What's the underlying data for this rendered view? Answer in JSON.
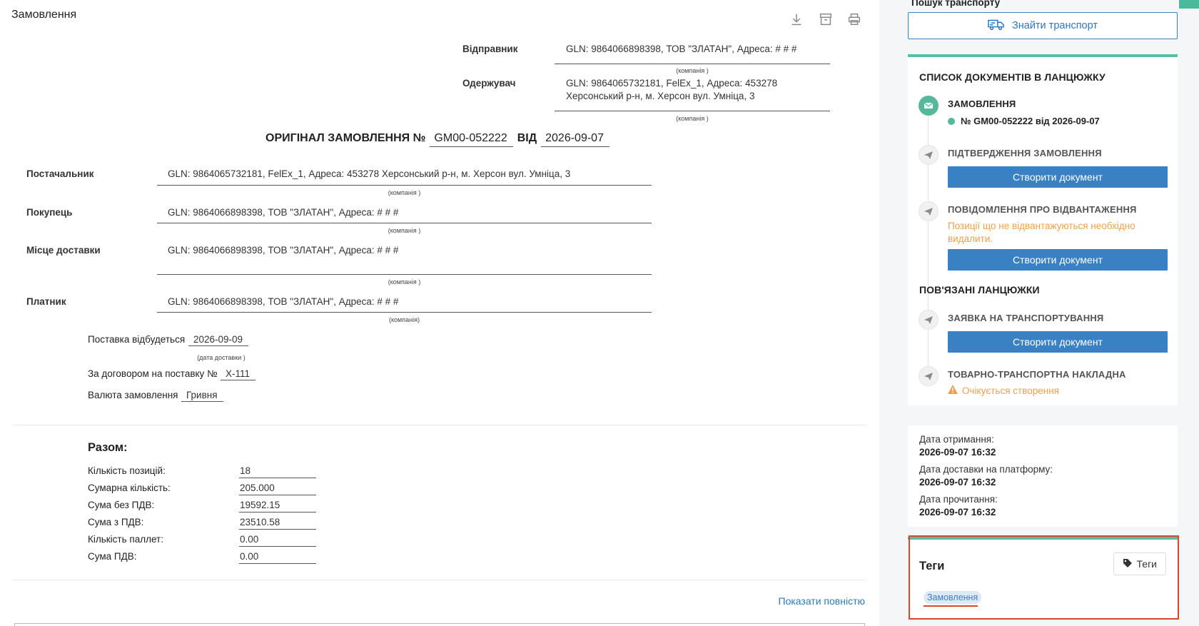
{
  "header": {
    "title": "Замовлення",
    "icons": [
      "download-icon",
      "archive-icon",
      "print-icon"
    ]
  },
  "parties_top": {
    "sender_label": "Відправник",
    "sender_value": "GLN: 9864066898398, ТОВ \"ЗЛАТАН\", Адреса: # # #",
    "sender_caption": "(компанія )",
    "receiver_label": "Одержувач",
    "receiver_line1": "GLN: 9864065732181, FelEx_1, Адреса: 453278",
    "receiver_line2": "Херсонський р-н, м. Херсон вул. Умніца, 3",
    "receiver_caption": "(компанія )"
  },
  "order_heading": {
    "prefix": "ОРИГІНАЛ ЗАМОВЛЕННЯ №",
    "number": "GM00-052222",
    "from_word": "ВІД",
    "date": "2026-09-07"
  },
  "parties": [
    {
      "label": "Постачальник",
      "value": "GLN: 9864065732181, FelEx_1, Адреса: 453278 Херсонський р-н, м. Херсон вул. Умніца, 3",
      "caption": "(компанія )"
    },
    {
      "label": "Покупець",
      "value": "GLN: 9864066898398, ТОВ \"ЗЛАТАН\", Адреса: # # #",
      "caption": "(компанія )"
    },
    {
      "label": "Місце доставки",
      "value": "GLN: 9864066898398, ТОВ \"ЗЛАТАН\", Адреса: # # #",
      "caption": "(компанія )"
    },
    {
      "label": "Платник",
      "value": "GLN: 9864066898398, ТОВ \"ЗЛАТАН\", Адреса: # # #",
      "caption": "(компанія)"
    }
  ],
  "delivery": {
    "label": "Поставка відбудеться",
    "date": "2026-09-09",
    "caption": "(дата доставки )",
    "contract_label": "За договором на поставку №",
    "contract_value": "X-111",
    "currency_label": "Валюта замовлення",
    "currency_value": "Гривня"
  },
  "totals": {
    "title": "Разом:",
    "rows": [
      {
        "label": "Кількість позицій:",
        "value": "18"
      },
      {
        "label": "Сумарна кількість:",
        "value": "205.000"
      },
      {
        "label": "Сума без ПДВ:",
        "value": "19592.15"
      },
      {
        "label": "Сума з ПДВ:",
        "value": "23510.58"
      },
      {
        "label": "Кількість паллет:",
        "value": "0.00"
      },
      {
        "label": "Сума ПДВ:",
        "value": "0.00"
      }
    ],
    "show_more": "Показати повністю"
  },
  "sidebar": {
    "transport_label": "Пошук транспорту",
    "find_transport_button": "Знайти транспорт",
    "chain_title": "СПИСОК ДОКУМЕНТІВ В ЛАНЦЮЖКУ",
    "order_step_title": "ЗАМОВЛЕННЯ",
    "order_doc_link": "№ GM00-052222 від 2026-09-07",
    "confirm_step_title": "ПІДТВЕРДЖЕННЯ ЗАМОВЛЕННЯ",
    "create_doc_label": "Створити документ",
    "shipment_step_title": "ПОВІДОМЛЕННЯ ПРО ВІДВАНТАЖЕННЯ",
    "shipment_warning": "Позиції що не відвантажуються необхідно видалити.",
    "related_title": "ПОВ'ЯЗАНІ ЛАНЦЮЖКИ",
    "transport_req_title": "ЗАЯВКА НА ТРАНСПОРТУВАННЯ",
    "waybill_title": "ТОВАРНО-ТРАНСПОРТНА НАКЛАДНА",
    "waybill_status": "Очікується створення",
    "colors": {
      "accent": "#55c1a2",
      "primary": "#3a81c4",
      "warning": "#f0a04b",
      "highlight": "#e0442c"
    }
  },
  "dates": {
    "received_label": "Дата отримання:",
    "received_value": "2026-09-07 16:32",
    "delivered_label": "Дата доставки на платформу:",
    "delivered_value": "2026-09-07 16:32",
    "read_label": "Дата прочитання:",
    "read_value": "2026-09-07 16:32"
  },
  "tags": {
    "title": "Теги",
    "button": "Теги",
    "items": [
      "Замовлення"
    ]
  }
}
